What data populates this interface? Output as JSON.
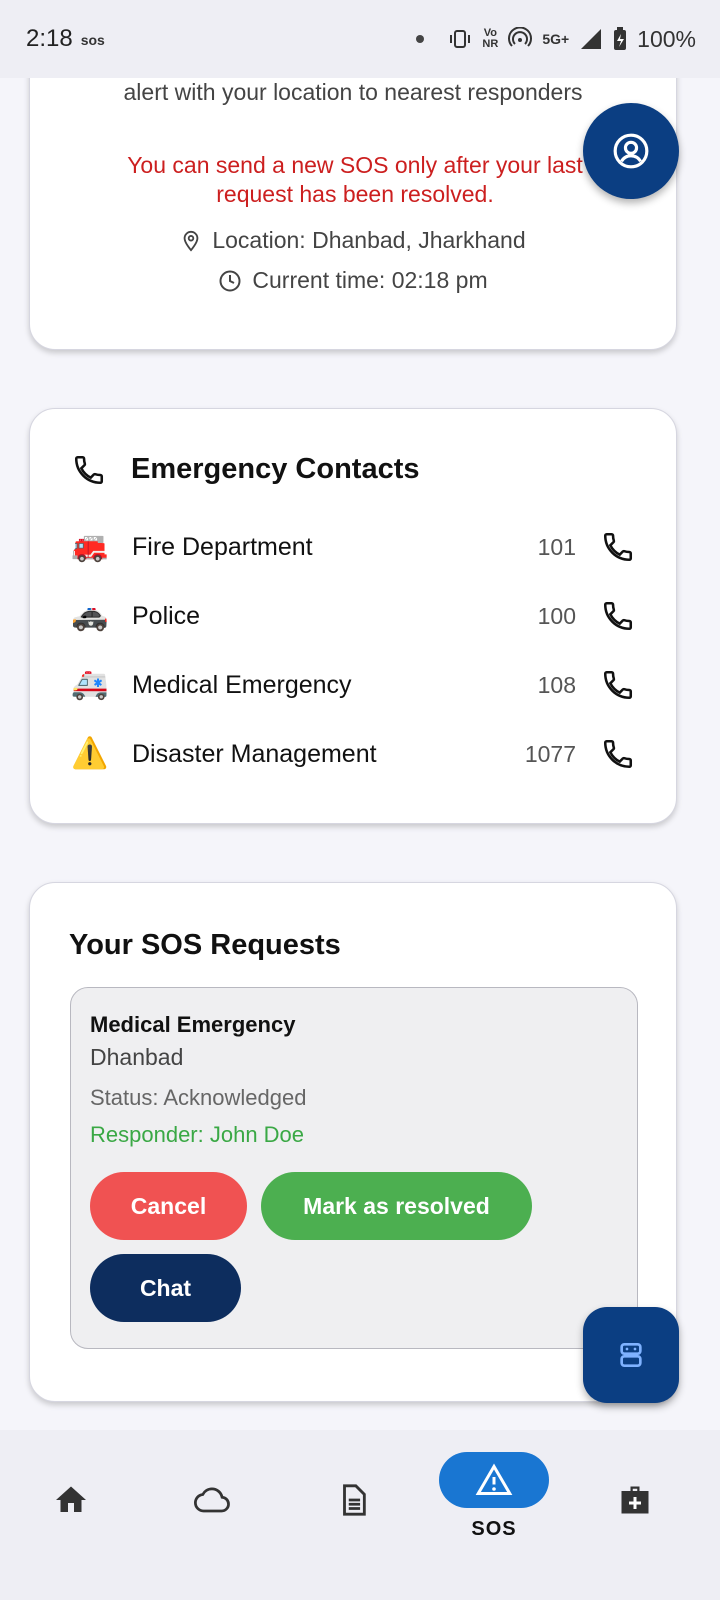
{
  "status_bar": {
    "time": "2:18",
    "sos_indicator": "sos",
    "network": "5G+",
    "volte": "Vo",
    "nr": "NR",
    "battery": "100%"
  },
  "alert_card": {
    "alert_text": "alert with your location to nearest responders",
    "warning": "You can send a new SOS only after your last request has been resolved.",
    "location": "Location: Dhanbad, Jharkhand",
    "current_time": "Current time: 02:18 pm",
    "warning_color": "#cc1f1f"
  },
  "emergency_contacts": {
    "title": "Emergency Contacts",
    "items": [
      {
        "emoji": "🚒",
        "name": "Fire Department",
        "number": "101"
      },
      {
        "emoji": "🚓",
        "name": "Police",
        "number": "100"
      },
      {
        "emoji": "🚑",
        "name": "Medical Emergency",
        "number": "108"
      },
      {
        "emoji": "⚠️",
        "name": "Disaster Management",
        "number": "1077"
      }
    ]
  },
  "sos_requests": {
    "title": "Your SOS Requests",
    "request": {
      "type": "Medical Emergency",
      "city": "Dhanbad",
      "status": "Status: Acknowledged",
      "responder": "Responder: John Doe",
      "cancel_label": "Cancel",
      "resolve_label": "Mark as resolved",
      "chat_label": "Chat"
    }
  },
  "bottom_nav": {
    "items": [
      {
        "icon": "home-icon",
        "label": ""
      },
      {
        "icon": "cloud-icon",
        "label": ""
      },
      {
        "icon": "document-icon",
        "label": ""
      },
      {
        "icon": "warning-icon",
        "label": "SOS",
        "active": true
      },
      {
        "icon": "medical-kit-icon",
        "label": ""
      }
    ],
    "active_color": "#1976d2"
  },
  "colors": {
    "fab": "#0b3e82",
    "cancel": "#f05252",
    "resolve": "#4caf50",
    "chat": "#0d2d5e",
    "responder": "#3aa845"
  }
}
